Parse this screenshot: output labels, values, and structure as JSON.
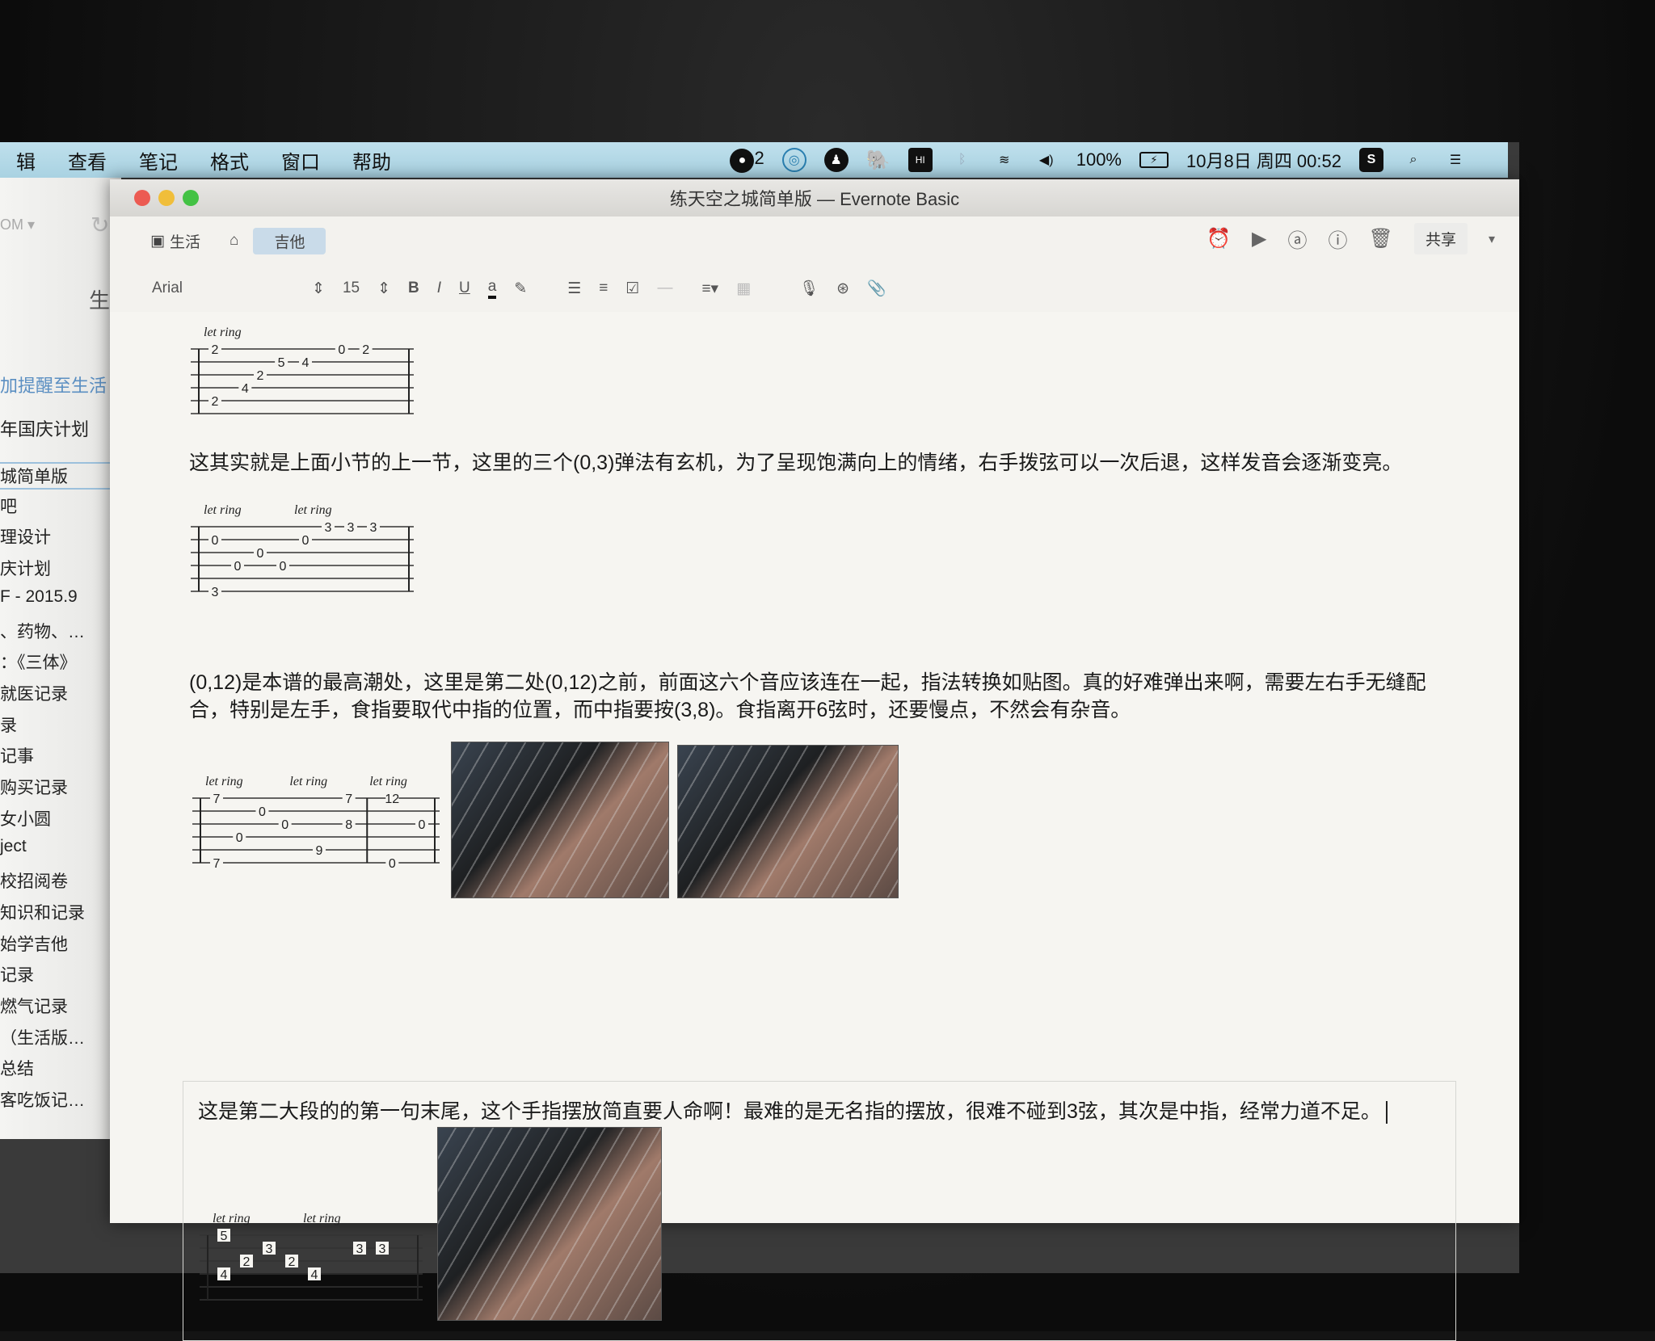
{
  "menubar": {
    "items": [
      "辑",
      "查看",
      "笔记",
      "格式",
      "窗口",
      "帮助"
    ],
    "badge": "2",
    "battery": "100%",
    "datetime": "10月8日 周四 00:52"
  },
  "backwindow": {
    "account": "OM ▾",
    "heading": "生活",
    "reminder": "加提醒至生活",
    "note_top": "年国庆计划",
    "items": [
      "城简单版",
      "吧",
      "理设计",
      "庆计划",
      "F - 2015.9",
      "、药物、…",
      "：《三体》",
      "就医记录",
      "录",
      "记事",
      "购买记录",
      "女小圆",
      "ject",
      "校招阅卷",
      "知识和记录",
      "始学吉他",
      "记录",
      "燃气记录",
      "（生活版…",
      "总结",
      "客吃饭记…"
    ]
  },
  "window": {
    "title": "练天空之城简单版 — Evernote Basic",
    "notebook": "生活",
    "tag": "吉他",
    "share": "共享",
    "font": "Arial",
    "size": "15",
    "fmt": [
      "B",
      "I",
      "U",
      "a"
    ]
  },
  "note": {
    "p2": "这其实就是上面小节的上一节，这里的三个(0,3)弹法有玄机，为了呈现饱满向上的情绪，右手拨弦可以一次后退，这样发音会逐渐变亮。",
    "p3": "(0,12)是本谱的最高潮处，这里是第二处(0,12)之前，前面这六个音应该连在一起，指法转换如贴图。真的好难弹出来啊，需要左右手无缝配合，特别是左手，食指要取代中指的位置，而中指要按(3,8)。食指离开6弦时，还要慢点，不然会有杂音。",
    "p4": "这是第二大段的的第一句末尾，这个手指摆放简直要人命啊！最难的是无名指的摆放，很难不碰到3弦，其次是中指，经常力道不足。"
  },
  "tabs": [
    {
      "letring": [
        {
          "t": "let ring",
          "step": 0
        }
      ],
      "steps": 6,
      "bars": [],
      "notes": [
        [
          1,
          0,
          "2"
        ],
        [
          5,
          0,
          "2"
        ],
        [
          4,
          1,
          "4"
        ],
        [
          3,
          1.5,
          "2"
        ],
        [
          2,
          2.2,
          "5"
        ],
        [
          2,
          3,
          "4"
        ],
        [
          1,
          4.2,
          "0"
        ],
        [
          1,
          5,
          "2"
        ]
      ]
    },
    {
      "letring": [
        {
          "t": "let ring",
          "step": 0
        },
        {
          "t": "let ring",
          "step": 4
        }
      ],
      "steps": 8,
      "bars": [],
      "notes": [
        [
          6,
          0,
          "3"
        ],
        [
          2,
          0,
          "0"
        ],
        [
          4,
          1,
          "0"
        ],
        [
          3,
          2,
          "0"
        ],
        [
          4,
          3,
          "0"
        ],
        [
          2,
          4,
          "0"
        ],
        [
          1,
          5,
          "3"
        ],
        [
          1,
          6,
          "3"
        ],
        [
          1,
          7,
          "3"
        ]
      ]
    },
    {
      "letring": [
        {
          "t": "let ring",
          "step": 0
        },
        {
          "t": "let ring",
          "step": 3.7
        },
        {
          "t": "let ring",
          "step": 7.2
        }
      ],
      "steps": 9,
      "bars": [
        6.6
      ],
      "notes": [
        [
          1,
          0,
          "7"
        ],
        [
          6,
          0,
          "7"
        ],
        [
          4,
          1,
          "0"
        ],
        [
          2,
          2,
          "0"
        ],
        [
          3,
          3,
          "0"
        ],
        [
          5,
          4.5,
          "9"
        ],
        [
          3,
          5.8,
          "8"
        ],
        [
          1,
          5.8,
          "7"
        ],
        [
          1,
          7.7,
          "12"
        ],
        [
          6,
          7.7,
          "0"
        ],
        [
          3,
          9,
          "0"
        ]
      ]
    },
    {
      "letring": [
        {
          "t": "let ring",
          "step": 0
        },
        {
          "t": "let ring",
          "step": 4
        }
      ],
      "steps": 8,
      "bars": [],
      "notes": [
        [
          1,
          0,
          "5"
        ],
        [
          4,
          0,
          "4"
        ],
        [
          3,
          1,
          "2"
        ],
        [
          2,
          2,
          "3"
        ],
        [
          3,
          3,
          "2"
        ],
        [
          4,
          4,
          "4"
        ],
        [
          2,
          6,
          "3"
        ],
        [
          2,
          7,
          "3"
        ]
      ]
    }
  ]
}
